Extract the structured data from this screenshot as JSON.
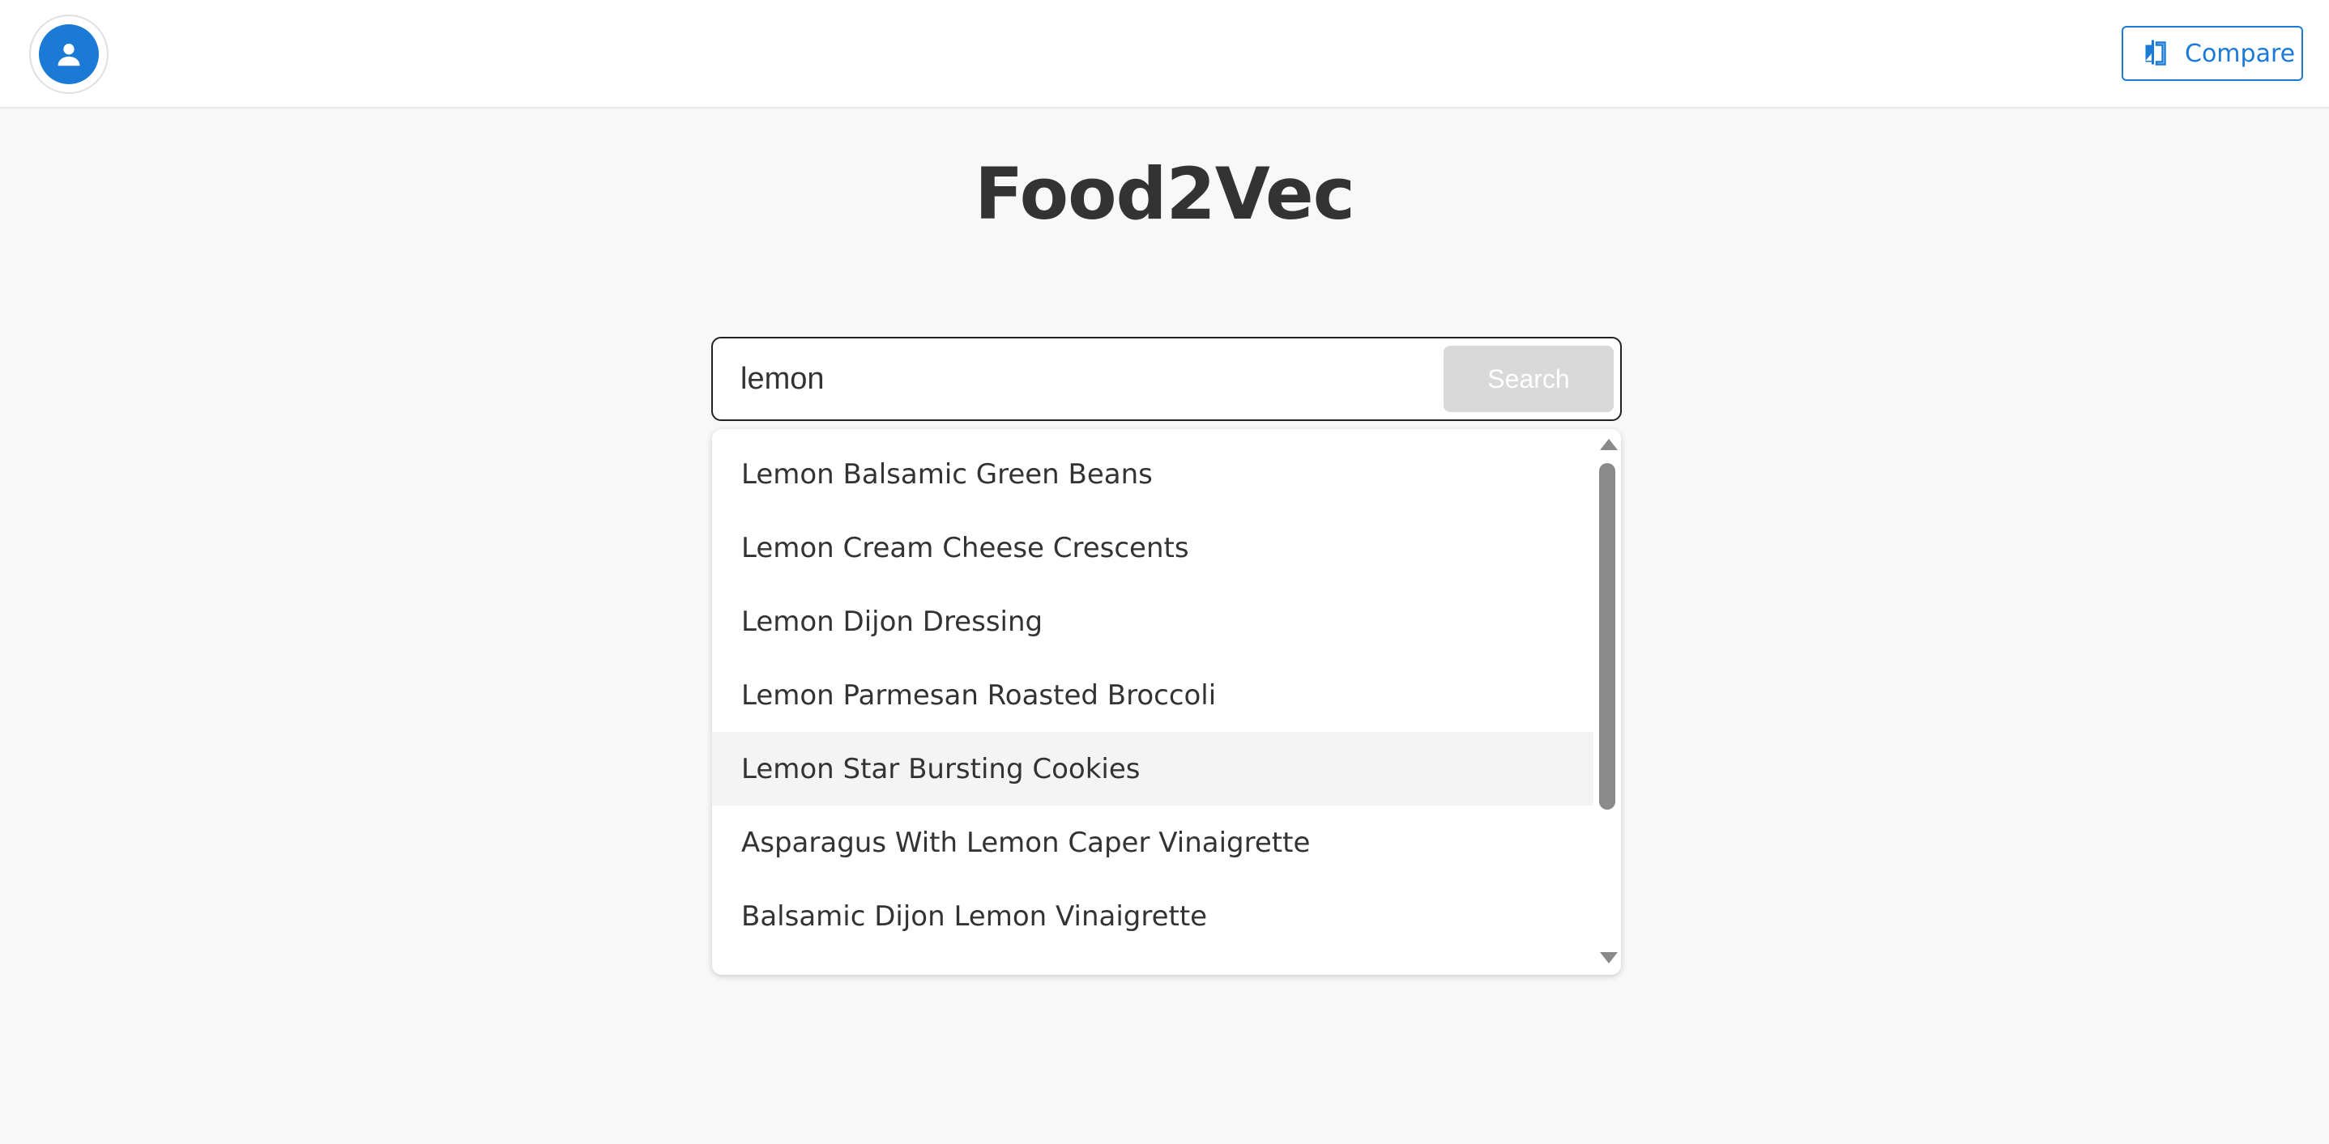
{
  "header": {
    "avatar_icon": "user-icon",
    "compare_label": "Compare",
    "compare_icon": "compare-icon",
    "accent_color": "#1a7ad6"
  },
  "main": {
    "title": "Food2Vec"
  },
  "search": {
    "value": "lemon",
    "placeholder": "",
    "button_label": "Search"
  },
  "suggestions": [
    "Lemon Balsamic Green Beans",
    "Lemon Cream Cheese Crescents",
    "Lemon Dijon Dressing",
    "Lemon Parmesan Roasted Broccoli",
    "Lemon Star Bursting Cookies",
    "Asparagus With Lemon Caper Vinaigrette",
    "Balsamic Dijon Lemon Vinaigrette"
  ],
  "hovered_suggestion": "Lemon Star Bursting Cookies"
}
